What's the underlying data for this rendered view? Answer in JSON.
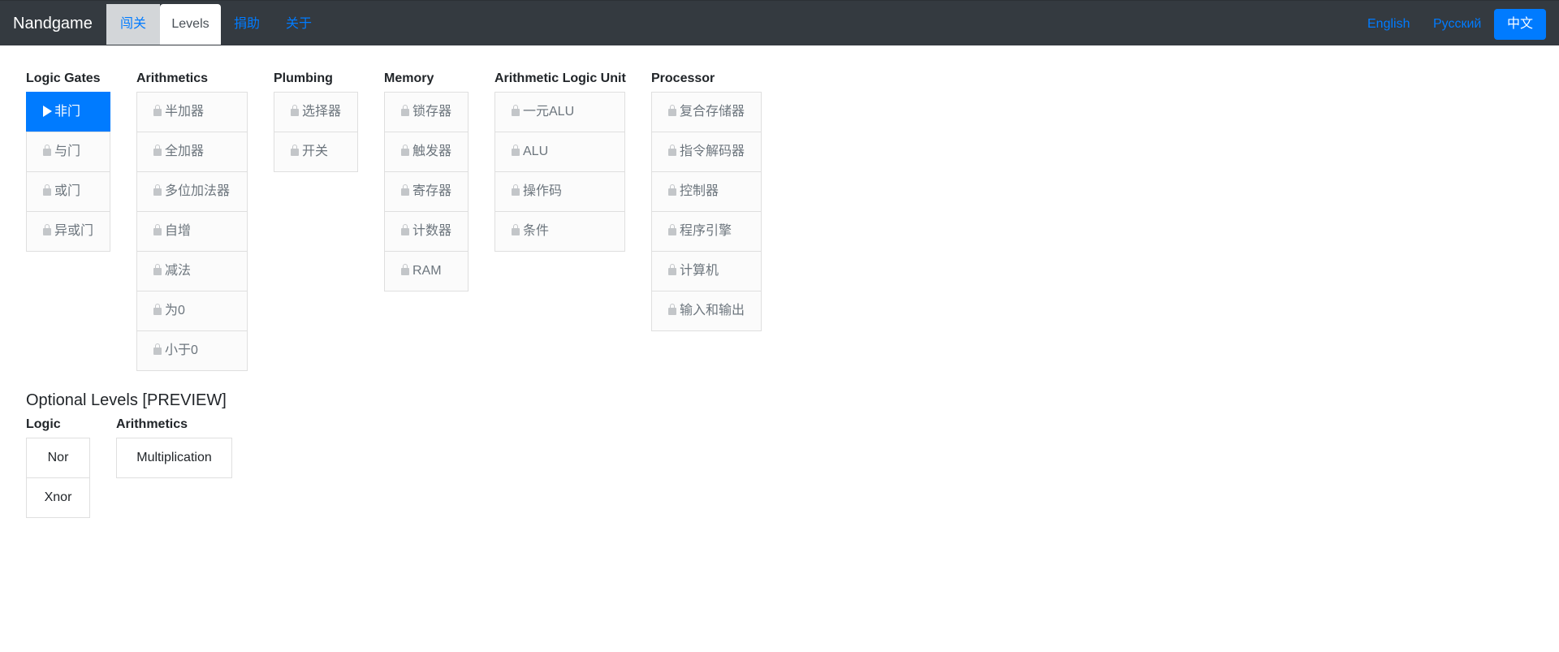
{
  "app": {
    "brand": "Nandgame"
  },
  "nav": {
    "challenge": "闯关",
    "levels": "Levels",
    "donate": "捐助",
    "about": "关于"
  },
  "languages": {
    "english": "English",
    "russian": "Русский",
    "chinese": "中文"
  },
  "categories": [
    {
      "heading": "Logic Gates",
      "items": [
        "非门",
        "与门",
        "或门",
        "异或门"
      ]
    },
    {
      "heading": "Arithmetics",
      "items": [
        "半加器",
        "全加器",
        "多位加法器",
        "自增",
        "减法",
        "为0",
        "小于0"
      ]
    },
    {
      "heading": "Plumbing",
      "items": [
        "选择器",
        "开关"
      ]
    },
    {
      "heading": "Memory",
      "items": [
        "锁存器",
        "触发器",
        "寄存器",
        "计数器",
        "RAM"
      ]
    },
    {
      "heading": "Arithmetic Logic Unit",
      "items": [
        "一元ALU",
        "ALU",
        "操作码",
        "条件"
      ]
    },
    {
      "heading": "Processor",
      "items": [
        "复合存储器",
        "指令解码器",
        "控制器",
        "程序引擎",
        "计算机",
        "输入和输出"
      ]
    }
  ],
  "optional": {
    "title": "Optional Levels [PREVIEW]",
    "categories": [
      {
        "heading": "Logic",
        "items": [
          "Nor",
          "Xnor"
        ]
      },
      {
        "heading": "Arithmetics",
        "items": [
          "Multiplication"
        ]
      }
    ]
  },
  "state": {
    "active_level": "非门"
  },
  "colors": {
    "topbar": "#343a40",
    "accent": "#007bff",
    "locked_text": "#6c757d",
    "border": "#dfdfdf"
  },
  "icons": {
    "locked": "lock-icon",
    "current": "play-icon"
  }
}
